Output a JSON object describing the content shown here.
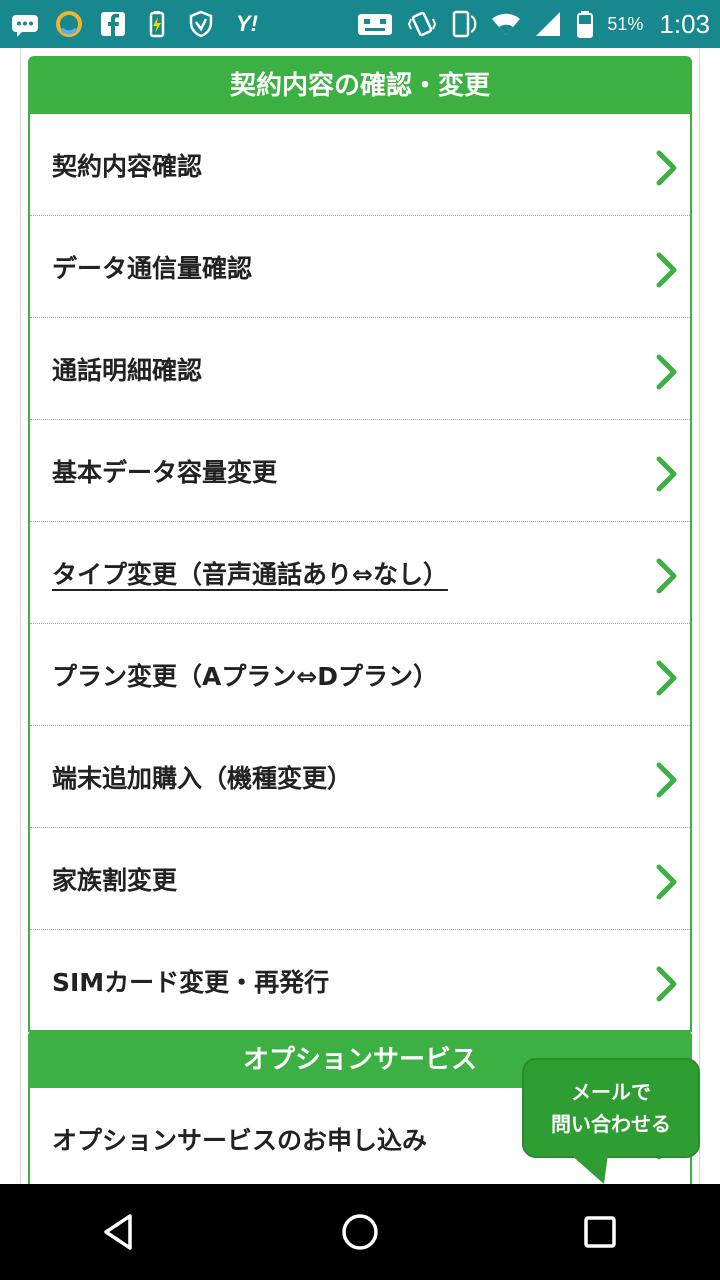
{
  "status_bar": {
    "icons_left": [
      "chat-icon",
      "ring-icon",
      "facebook-icon",
      "battery-saver-icon",
      "shield-icon",
      "yahoo-icon"
    ],
    "icons_right": [
      "mail-robot-icon",
      "vibrate-icon",
      "rotate-icon",
      "wifi-icon",
      "signal-icon",
      "battery-icon"
    ],
    "yahoo_text": "Y!",
    "battery_percent": "51%",
    "time": "1:03"
  },
  "contract_section": {
    "header": "契約内容の確認・変更",
    "items": [
      {
        "label": "契約内容確認"
      },
      {
        "label": "データ通信量確認"
      },
      {
        "label": "通話明細確認"
      },
      {
        "label": "基本データ容量変更"
      },
      {
        "label": "タイプ変更（音声通話あり⇔なし）"
      },
      {
        "label": "プラン変更（Aプラン⇔Dプラン）"
      },
      {
        "label": "端末追加購入（機種変更）"
      },
      {
        "label": "家族割変更"
      },
      {
        "label": "SIMカード変更・再発行"
      }
    ]
  },
  "option_section": {
    "header": "オプションサービス",
    "items": [
      {
        "label": "オプションサービスのお申し込み"
      }
    ]
  },
  "mail_bubble": {
    "line1": "メールで",
    "line2": "問い合わせる"
  },
  "colors": {
    "status_bar": "#16888e",
    "accent_green": "#3cb043",
    "bubble_green": "#2e9e33",
    "nav_bar": "#000000"
  }
}
